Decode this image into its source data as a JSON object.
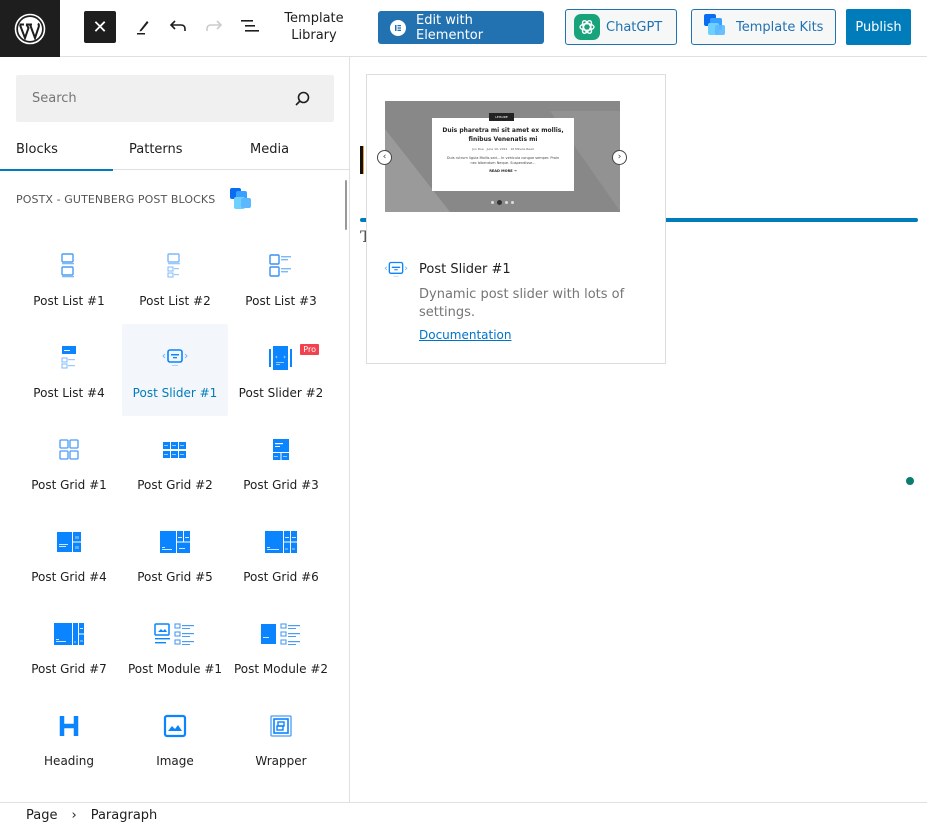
{
  "topbar": {
    "logo": "wordpress-logo",
    "close_icon": "✕",
    "template_library_label": "Template Library",
    "elementor_button": "Edit with Elementor",
    "chatgpt_button": "ChatGPT",
    "template_kits_button": "Template Kits",
    "publish_button": "Publish"
  },
  "sidebar": {
    "search_placeholder": "Search",
    "tabs": [
      {
        "label": "Blocks",
        "active": true
      },
      {
        "label": "Patterns",
        "active": false
      },
      {
        "label": "Media",
        "active": false
      }
    ],
    "category_title": "POSTX - GUTENBERG POST BLOCKS",
    "blocks": [
      {
        "label": "Post List #1",
        "icon": "post-list-1-icon"
      },
      {
        "label": "Post List #2",
        "icon": "post-list-2-icon"
      },
      {
        "label": "Post List #3",
        "icon": "post-list-3-icon"
      },
      {
        "label": "Post List #4",
        "icon": "post-list-4-icon"
      },
      {
        "label": "Post Slider #1",
        "icon": "post-slider-1-icon",
        "selected": true
      },
      {
        "label": "Post Slider #2",
        "icon": "post-slider-2-icon",
        "badge": "Pro"
      },
      {
        "label": "Post Grid #1",
        "icon": "post-grid-1-icon"
      },
      {
        "label": "Post Grid #2",
        "icon": "post-grid-2-icon"
      },
      {
        "label": "Post Grid #3",
        "icon": "post-grid-3-icon"
      },
      {
        "label": "Post Grid #4",
        "icon": "post-grid-4-icon"
      },
      {
        "label": "Post Grid #5",
        "icon": "post-grid-5-icon"
      },
      {
        "label": "Post Grid #6",
        "icon": "post-grid-6-icon"
      },
      {
        "label": "Post Grid #7",
        "icon": "post-grid-7-icon"
      },
      {
        "label": "Post Module #1",
        "icon": "post-module-1-icon"
      },
      {
        "label": "Post Module #2",
        "icon": "post-module-2-icon"
      },
      {
        "label": "Heading",
        "icon": "heading-icon"
      },
      {
        "label": "Image",
        "icon": "image-icon"
      },
      {
        "label": "Wrapper",
        "icon": "wrapper-icon"
      }
    ]
  },
  "preview": {
    "slide": {
      "tag": "LEISURE",
      "title": "Duis pharetra mi sit amet ex mollis, finibus Venenatis mi",
      "meta_author": "Jon Doe",
      "meta_date": "June 10, 2021",
      "meta_read": "10 Minute Read",
      "excerpt": "Duis rutrum ligula Mollis sed... In vehicula congue semper. Proin nec bibendum Neque. Suspendisse...",
      "read_more": "READ MORE →"
    },
    "title": "Post Slider #1",
    "description": "Dynamic post slider with lots of settings.",
    "doc_link": "Documentation"
  },
  "canvas": {
    "partial_text": "T"
  },
  "footer": {
    "breadcrumb": [
      "Page",
      "Paragraph"
    ],
    "separator": "›"
  },
  "colors": {
    "primary": "#007cba",
    "elementor": "#2271b1",
    "chatgpt_green": "#19a37b",
    "postx_blue": "#0a84ff",
    "pro_badge": "#f2424e",
    "dark": "#1e1e1e"
  }
}
